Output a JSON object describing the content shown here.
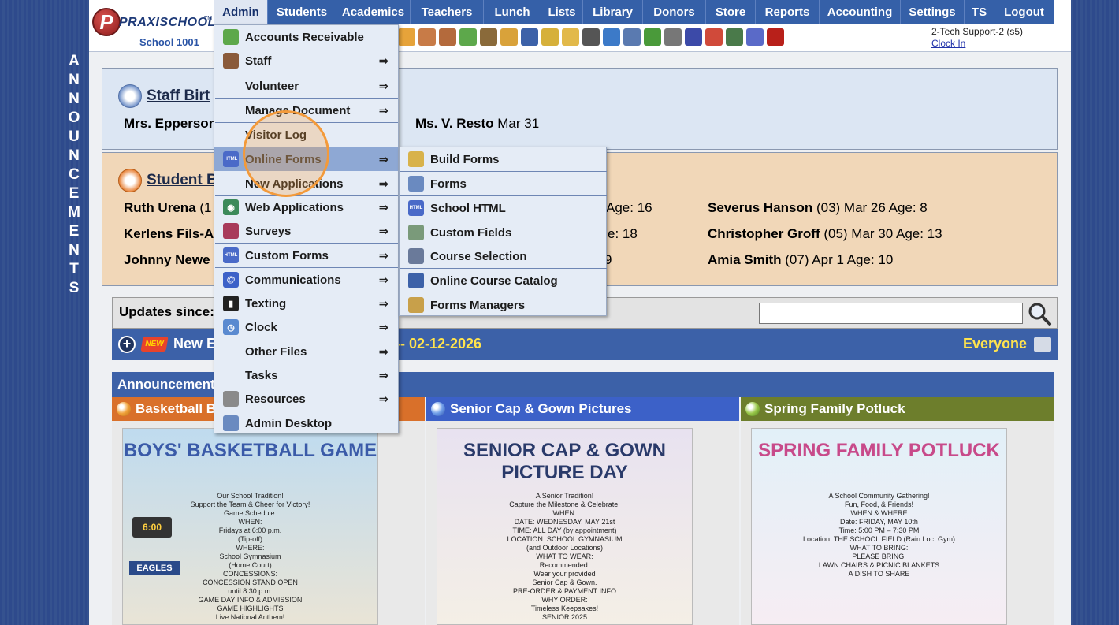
{
  "vertical_label": "ANNOUNCEMENTS",
  "logo": {
    "brand": "PRAXISCHOOL",
    "tm": "TM",
    "school": "School 1001"
  },
  "nav": [
    "Admin",
    "Students",
    "Academics",
    "Teachers",
    "Lunch",
    "Lists",
    "Library",
    "Donors",
    "Store",
    "Reports",
    "Accounting",
    "Settings",
    "TS",
    "Logout"
  ],
  "support": {
    "user": "2-Tech Support-2 (s5)",
    "clock": "Clock In"
  },
  "staff_birthdays": {
    "title": "Staff Birt",
    "entries": [
      {
        "name": "Mrs. Epperson",
        "date": ""
      },
      {
        "name": "Ms. V. Resto",
        "date": "Mar 31"
      }
    ]
  },
  "student_birthdays": {
    "title": "Student B",
    "col1": [
      {
        "name": "Ruth Urena",
        "detail": "(1"
      },
      {
        "name": "Kerlens Fils-A",
        "detail": ""
      },
      {
        "name": "Johnny Newe",
        "detail": ""
      }
    ],
    "col2": [
      "Age: 16",
      "e: 18",
      "9"
    ],
    "col3": [
      {
        "name": "Severus Hanson",
        "detail": "(03) Mar 26 Age: 8"
      },
      {
        "name": "Christopher Groff",
        "detail": "(05) Mar 30 Age: 13"
      },
      {
        "name": "Amia Smith",
        "detail": "(07) Apr 1 Age: 10"
      }
    ]
  },
  "updates": {
    "label": "Updates since:",
    "search_placeholder": ""
  },
  "newbar": {
    "new_badge": "NEW",
    "label": "New E",
    "date": "-- 02-12-2026",
    "audience": "Everyone"
  },
  "announcements": {
    "title": "Announcements",
    "cards": [
      {
        "title": "Basketball B",
        "poster_title": "BOYS' BASKETBALL GAME",
        "lines": [
          "Our School Tradition!",
          "Support the Team & Cheer for Victory!",
          "Game Schedule:",
          "WHEN:",
          "Fridays at 6:00 p.m.",
          "(Tip-off)",
          "WHERE:",
          "School Gymnasium",
          "(Home Court)",
          "CONCESSIONS:",
          "CONCESSION STAND OPEN",
          "until 8:30 p.m.",
          "GAME DAY INFO & ADMISSION",
          "GAME HIGHLIGHTS",
          "Live National Anthem!"
        ],
        "scoreboard": "6:00",
        "team": "EAGLES",
        "color": "#d9702a"
      },
      {
        "title": "Senior Cap & Gown Pictures",
        "poster_title": "SENIOR CAP & GOWN PICTURE DAY",
        "lines": [
          "A Senior Tradition!",
          "Capture the Milestone & Celebrate!",
          "WHEN:",
          "DATE: WEDNESDAY, MAY 21st",
          "TIME: ALL DAY (by appointment)",
          "LOCATION: SCHOOL GYMNASIUM",
          "(and Outdoor Locations)",
          "WHAT TO WEAR:",
          "Recommended:",
          "Wear your provided",
          "Senior Cap & Gown.",
          "PRE-ORDER & PAYMENT INFO",
          "WHY ORDER:",
          "Timeless Keepsakes!",
          "SENIOR 2025"
        ],
        "color": "#3c61c8"
      },
      {
        "title": "Spring Family Potluck",
        "poster_title": "SPRING FAMILY POTLUCK",
        "lines": [
          "A School Community Gathering!",
          "Fun, Food, & Friends!",
          "WHEN & WHERE",
          "Date: FRIDAY, MAY 10th",
          "Time: 5:00 PM – 7:30 PM",
          "Location: THE SCHOOL FIELD (Rain Loc: Gym)",
          "WHAT TO BRING:",
          "PLEASE BRING:",
          "LAWN CHAIRS & PICNIC BLANKETS",
          "A DISH TO SHARE"
        ],
        "color": "#6d7e2c"
      }
    ]
  },
  "admin_menu": [
    {
      "label": "Accounts Receivable",
      "icon": "money-icon",
      "arrow": ""
    },
    {
      "label": "Staff",
      "icon": "person-icon",
      "arrow": "⇒"
    },
    {
      "label": "Volunteer",
      "icon": "",
      "arrow": "⇒"
    },
    {
      "label": "Manage Document",
      "icon": "",
      "arrow": "⇒"
    },
    {
      "label": "Visitor Log",
      "icon": "",
      "arrow": ""
    },
    {
      "label": "Online Forms",
      "icon": "html-icon",
      "arrow": "⇒"
    },
    {
      "label": "New Applications",
      "icon": "",
      "arrow": "⇒"
    },
    {
      "label": "Web Applications",
      "icon": "globe-icon",
      "arrow": "⇒"
    },
    {
      "label": "Surveys",
      "icon": "survey-icon",
      "arrow": "⇒"
    },
    {
      "label": "Custom Forms",
      "icon": "html-icon",
      "arrow": "⇒"
    },
    {
      "label": "Communications",
      "icon": "at-icon",
      "arrow": "⇒"
    },
    {
      "label": "Texting",
      "icon": "phone-icon",
      "arrow": "⇒"
    },
    {
      "label": "Clock",
      "icon": "clock-icon",
      "arrow": "⇒"
    },
    {
      "label": "Other Files",
      "icon": "",
      "arrow": "⇒"
    },
    {
      "label": "Tasks",
      "icon": "",
      "arrow": "⇒"
    },
    {
      "label": "Resources",
      "icon": "resources-icon",
      "arrow": "⇒"
    },
    {
      "label": "Admin Desktop",
      "icon": "desktop-icon",
      "arrow": ""
    }
  ],
  "online_forms_menu": [
    {
      "label": "Build Forms",
      "icon": "build-forms-icon"
    },
    {
      "label": "Forms",
      "icon": "forms-icon"
    },
    {
      "label": "School HTML",
      "icon": "html-icon"
    },
    {
      "label": "Custom Fields",
      "icon": "custom-fields-icon"
    },
    {
      "label": "Course Selection",
      "icon": "list-icon"
    },
    {
      "label": "Online Course Catalog",
      "icon": "book-icon"
    },
    {
      "label": "Forms Managers",
      "icon": "managers-icon"
    }
  ],
  "colors": {
    "nav_bg": "#3560a8",
    "staff_bg": "#dce6f3",
    "students_bg": "#f1d7b8",
    "highlight": "#8ea8d4",
    "focus_ring": "#f39a3a"
  }
}
